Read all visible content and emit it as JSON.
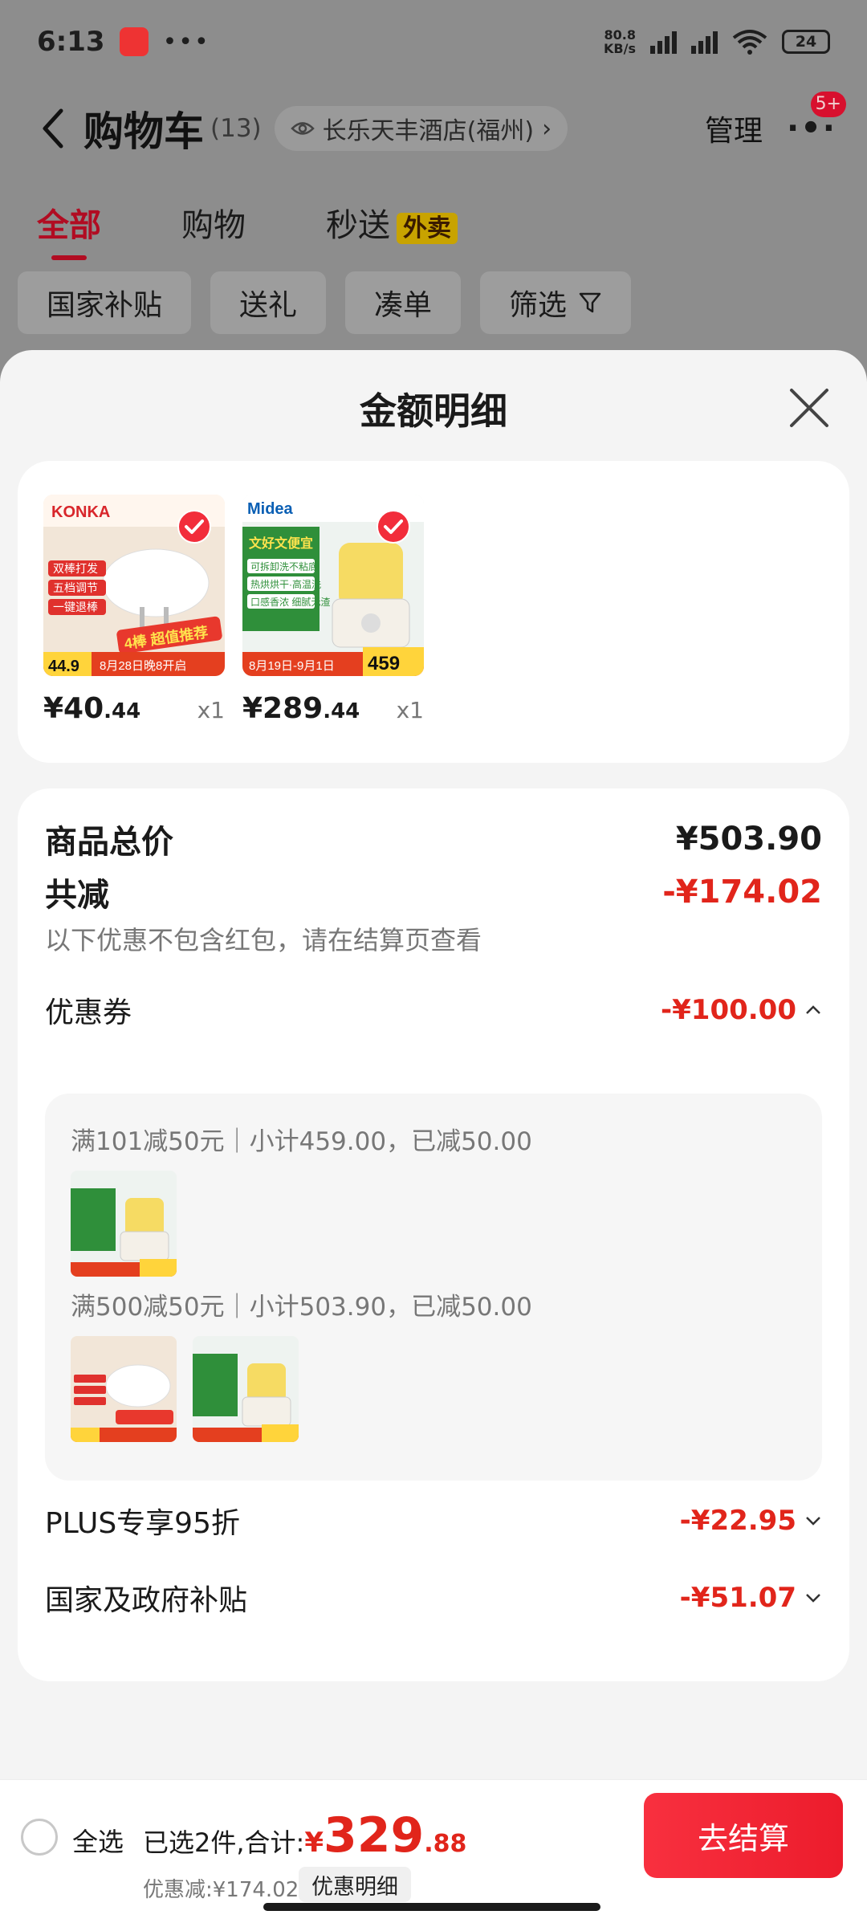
{
  "status": {
    "time": "6:13",
    "dots": "•••",
    "net_speed": "80.8",
    "net_unit": "KB/s",
    "battery": "24"
  },
  "header": {
    "title": "购物车",
    "count": "(13)",
    "address": "长乐天丰酒店(福州)",
    "address_arrow": "›",
    "manage": "管理",
    "badge": "5+"
  },
  "tabs": [
    {
      "label": "全部"
    },
    {
      "label": "购物"
    },
    {
      "label": "秒送",
      "tag": "外卖"
    }
  ],
  "chips": [
    "国家补贴",
    "送礼",
    "凑单",
    "筛选"
  ],
  "sheet": {
    "title": "金额明细",
    "products": [
      {
        "price_int": "¥40",
        "price_dec": ".44",
        "qty": "x1",
        "img_brand": "KONKA",
        "img_price": "44.9",
        "img_tag": "4棒 超值推荐",
        "img_lines": [
          "双棒打发",
          "五档调节",
          "一键退棒"
        ],
        "img_banner": "8月28日晚8开启"
      },
      {
        "price_int": "¥289",
        "price_dec": ".44",
        "qty": "x1",
        "img_brand": "Midea",
        "img_price": "459",
        "img_tag": "文好文便宜",
        "img_lines": [
          "可拆卸洗不粘底",
          "热烘烘干·高温洗",
          "口感香浓 细腻无渣"
        ],
        "img_banner": "8月19日-9月1日"
      }
    ],
    "total": {
      "label": "商品总价",
      "value": "¥503.90"
    },
    "reduce": {
      "label": "共减",
      "value": "-¥174.02",
      "note": "以下优惠不包含红包，请在结算页查看"
    },
    "coupon": {
      "label": "优惠券",
      "value": "-¥100.00",
      "rules": [
        "满101减50元｜小计459.00，已减50.00",
        "满500减50元｜小计503.90，已减50.00"
      ]
    },
    "plus": {
      "label": "PLUS专享95折",
      "value": "-¥22.95"
    },
    "subsidy": {
      "label": "国家及政府补贴",
      "value": "-¥51.07"
    }
  },
  "bottom": {
    "select_all": "全选",
    "summary_prefix": "已选2件,合计:",
    "currency": "¥",
    "total_int": "329",
    "total_dec": ".88",
    "discount": "优惠减:¥174.02",
    "discount_button": "优惠明细",
    "checkout": "去结算"
  },
  "colors": {
    "accent": "#e1251b",
    "tab_active": "#b10c22",
    "checkout": "#f8303f"
  }
}
